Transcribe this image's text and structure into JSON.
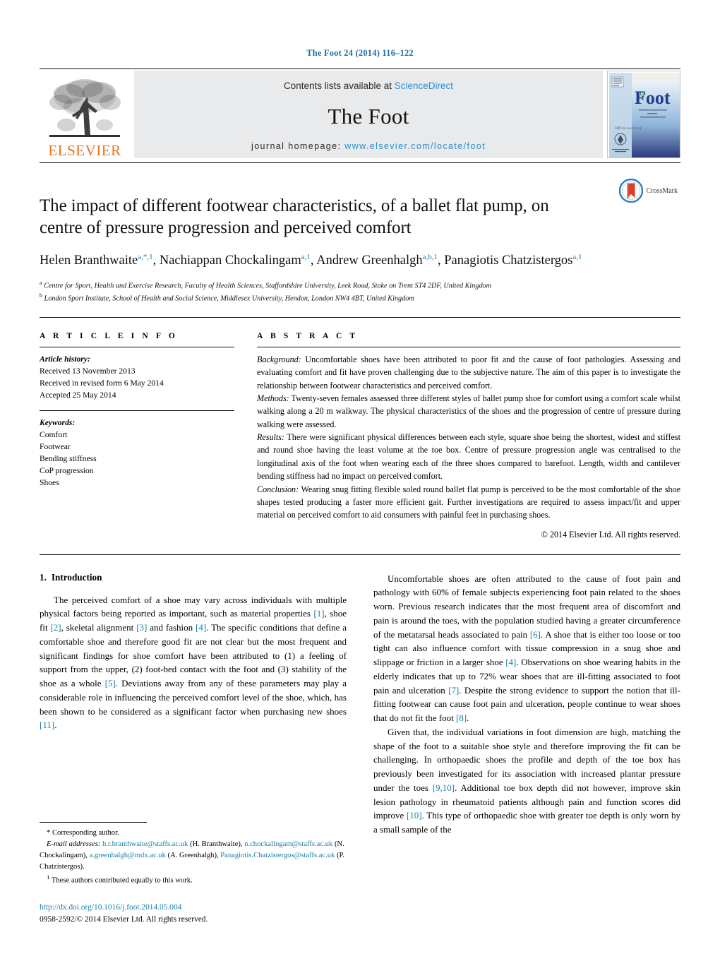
{
  "running_head": "The Foot 24 (2014) 116–122",
  "banner": {
    "publisher_logo_text": "ELSEVIER",
    "contents_prefix": "Contents lists available at ",
    "contents_link": "ScienceDirect",
    "journal_title": "The Foot",
    "homepage_prefix": "journal homepage: ",
    "homepage_url": "www.elsevier.com/locate/foot",
    "cover_title_small": "The",
    "cover_title_large": "Foot",
    "cover_subtitle": "The International Journal of Clinical Foot Science",
    "cover_official": "Official Journal of"
  },
  "article": {
    "title": "The impact of different footwear characteristics, of a ballet flat pump, on centre of pressure progression and perceived comfort",
    "crossmark_label": "CrossMark",
    "authors": [
      {
        "name": "Helen Branthwaite",
        "sup": "a,*,1",
        "sep": ", "
      },
      {
        "name": "Nachiappan Chockalingam",
        "sup": "a,1",
        "sep": ", "
      },
      {
        "name": "Andrew Greenhalgh",
        "sup": "a,b,1",
        "sep": ", "
      },
      {
        "name": "Panagiotis Chatzistergos",
        "sup": "a,1",
        "sep": ""
      }
    ],
    "affiliations": [
      {
        "marker": "a",
        "text": "Centre for Sport, Health and Exercise Research, Faculty of Health Sciences, Staffordshire University, Leek Road, Stoke on Trent ST4 2DF, United Kingdom"
      },
      {
        "marker": "b",
        "text": "London Sport Institute, School of Health and Social Science, Middlesex University, Hendon, London NW4 4BT, United Kingdom"
      }
    ]
  },
  "article_info": {
    "heading": "A R T I C L E    I N F O",
    "history_label": "Article history:",
    "history": [
      "Received 13 November 2013",
      "Received in revised form 6 May 2014",
      "Accepted 25 May 2014"
    ],
    "keywords_label": "Keywords:",
    "keywords": [
      "Comfort",
      "Footwear",
      "Bending stiffness",
      "CoP progression",
      "Shoes"
    ]
  },
  "abstract": {
    "heading": "A B S T R A C T",
    "sections": [
      {
        "lead": "Background:",
        "text": " Uncomfortable shoes have been attributed to poor fit and the cause of foot pathologies. Assessing and evaluating comfort and fit have proven challenging due to the subjective nature. The aim of this paper is to investigate the relationship between footwear characteristics and perceived comfort."
      },
      {
        "lead": "Methods:",
        "text": " Twenty-seven females assessed three different styles of ballet pump shoe for comfort using a comfort scale whilst walking along a 20 m walkway. The physical characteristics of the shoes and the progression of centre of pressure during walking were assessed."
      },
      {
        "lead": "Results:",
        "text": " There were significant physical differences between each style, square shoe being the shortest, widest and stiffest and round shoe having the least volume at the toe box. Centre of pressure progression angle was centralised to the longitudinal axis of the foot when wearing each of the three shoes compared to barefoot. Length, width and cantilever bending stiffness had no impact on perceived comfort."
      },
      {
        "lead": "Conclusion:",
        "text": " Wearing snug fitting flexible soled round ballet flat pump is perceived to be the most comfortable of the shoe shapes tested producing a faster more efficient gait. Further investigations are required to assess impact/fit and upper material on perceived comfort to aid consumers with painful feet in purchasing shoes."
      }
    ],
    "copyright": "© 2014 Elsevier Ltd. All rights reserved."
  },
  "introduction": {
    "number": "1.",
    "heading": "Introduction",
    "left_paragraphs": [
      "The perceived comfort of a shoe may vary across individuals with multiple physical factors being reported as important, such as material properties [1], shoe fit [2], skeletal alignment [3] and fashion [4]. The specific conditions that define a comfortable shoe and therefore good fit are not clear but the most frequent and significant findings for shoe comfort have been attributed to (1) a feeling of support from the upper, (2) foot-bed contact with the foot and (3) stability of the shoe as a whole [5]. Deviations away from any of these parameters may play a considerable role in influencing the perceived comfort level of the shoe, which, has been shown to be considered as a significant factor when purchasing new shoes [11]."
    ],
    "right_paragraphs": [
      "Uncomfortable shoes are often attributed to the cause of foot pain and pathology with 60% of female subjects experiencing foot pain related to the shoes worn. Previous research indicates that the most frequent area of discomfort and pain is around the toes, with the population studied having a greater circumference of the metatarsal heads associated to pain [6]. A shoe that is either too loose or too tight can also influence comfort with tissue compression in a snug shoe and slippage or friction in a larger shoe [4]. Observations on shoe wearing habits in the elderly indicates that up to 72% wear shoes that are ill-fitting associated to foot pain and ulceration [7]. Despite the strong evidence to support the notion that ill-fitting footwear can cause foot pain and ulceration, people continue to wear shoes that do not fit the foot [8].",
      "Given that, the individual variations in foot dimension are high, matching the shape of the foot to a suitable shoe style and therefore improving the fit can be challenging. In orthopaedic shoes the profile and depth of the toe box has previously been investigated for its association with increased plantar pressure under the toes [9,10]. Additional toe box depth did not however, improve skin lesion pathology in rheumatoid patients although pain and function scores did improve [10]. This type of orthopaedic shoe with greater toe depth is only worn by a small sample of the"
    ]
  },
  "footnote": {
    "corresponding_marker": "*",
    "corresponding_text": "Corresponding author.",
    "email_label": "E-mail addresses:",
    "emails": [
      {
        "address": "h.r.branthwaite@staffs.ac.uk",
        "person": " (H. Branthwaite), "
      },
      {
        "address": "n.chockalingam@staffs.ac.uk",
        "person": " (N. Chockalingam), "
      },
      {
        "address": "a.greenhalgh@mdx.ac.uk",
        "person": " (A. Greenhalgh), "
      },
      {
        "address": "Panagiotis.Chatzistergos@staffs.ac.uk",
        "person": " (P. Chatzistergos)."
      }
    ],
    "equal_marker": "1",
    "equal_text": "These authors contributed equally to this work."
  },
  "doi_block": {
    "doi": "http://dx.doi.org/10.1016/j.foot.2014.05.004",
    "issn_line": "0958-2592/© 2014 Elsevier Ltd. All rights reserved."
  },
  "colors": {
    "link": "#1a7fa8",
    "banner_link": "#2a8fd0",
    "elsevier_orange": "#E9711C",
    "banner_bg": "#e9eaec"
  }
}
